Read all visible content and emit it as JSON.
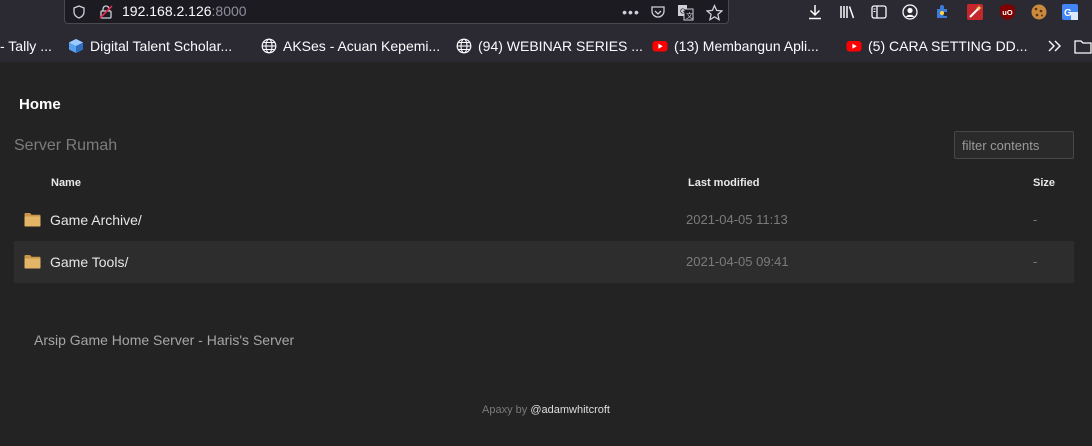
{
  "browser": {
    "url_host": "192.168.2.126",
    "url_port": ":8000",
    "page_actions_icon": "three-dots-icon",
    "bookmarks": [
      {
        "label": "- Tally ...",
        "icon": "none"
      },
      {
        "label": "Digital Talent Scholar...",
        "icon": "cube-icon"
      },
      {
        "label": "AKSes - Acuan Kepemi...",
        "icon": "globe-icon"
      },
      {
        "label": "(94) WEBINAR SERIES ...",
        "icon": "globe-icon"
      },
      {
        "label": "(13) Membangun Apli...",
        "icon": "youtube-icon"
      },
      {
        "label": "(5) CARA SETTING DD...",
        "icon": "youtube-icon"
      }
    ],
    "colors": {
      "chrome_bg": "#2b2a33",
      "urlbar_bg": "#1c1b22",
      "youtube_red": "#ff0000"
    }
  },
  "page": {
    "title": "Home",
    "server_name": "Server Rumah",
    "filter_placeholder": "filter contents",
    "columns": {
      "name": "Name",
      "modified": "Last modified",
      "size": "Size"
    },
    "rows": [
      {
        "name": "Game Archive/",
        "modified": "2021-04-05 11:13",
        "size": "-"
      },
      {
        "name": "Game Tools/",
        "modified": "2021-04-05 09:41",
        "size": "-"
      }
    ],
    "readme": "Arsip Game Home Server - Haris's Server",
    "footer": {
      "prefix": "Apaxy by ",
      "author": "@adamwhitcroft"
    },
    "colors": {
      "background": "#232323",
      "row_alt": "#2d2d2d",
      "folder": "#d9a94f"
    }
  }
}
